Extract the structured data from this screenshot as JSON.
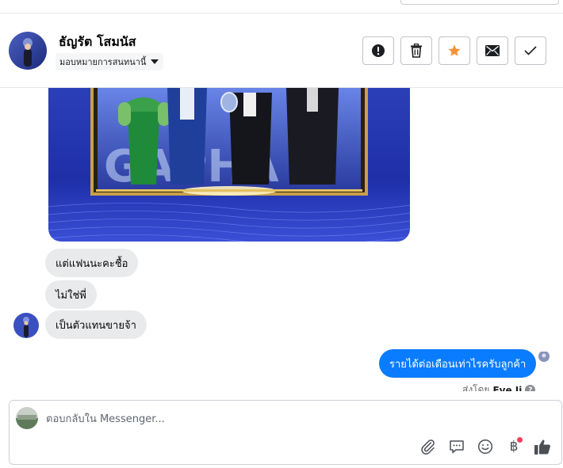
{
  "header": {
    "contact_name": "ธัญรัต โสมนัส",
    "assign_label": "มอบหมายการสนทนานี้"
  },
  "actions": [
    {
      "name": "mark-spam-button",
      "icon": "alert-icon"
    },
    {
      "name": "delete-button",
      "icon": "trash-icon"
    },
    {
      "name": "star-button",
      "icon": "star-icon",
      "color": "#f7923a"
    },
    {
      "name": "mark-unread-button",
      "icon": "envelope-icon"
    },
    {
      "name": "mark-done-button",
      "icon": "check-icon"
    }
  ],
  "messages": [
    {
      "side": "in",
      "text": "แต่แฟนนะคะชื้อ"
    },
    {
      "side": "in",
      "text": "ไม่ใช่พี่"
    },
    {
      "side": "in",
      "text": "เป็นตัวแทนขายจ้า"
    },
    {
      "side": "out",
      "text": "รายได้ต่อเดือนเท่าไรครับลูกค้า"
    }
  ],
  "sent_by": {
    "prefix": "ส่งโดย",
    "name": "Eve Ji"
  },
  "composer": {
    "placeholder": "ตอบกลับใน Messenger..."
  },
  "colors": {
    "outgoing_bubble": "#0a7cff",
    "incoming_bubble": "#e9eaec",
    "star": "#f7923a",
    "notification": "#fa3e5a"
  }
}
